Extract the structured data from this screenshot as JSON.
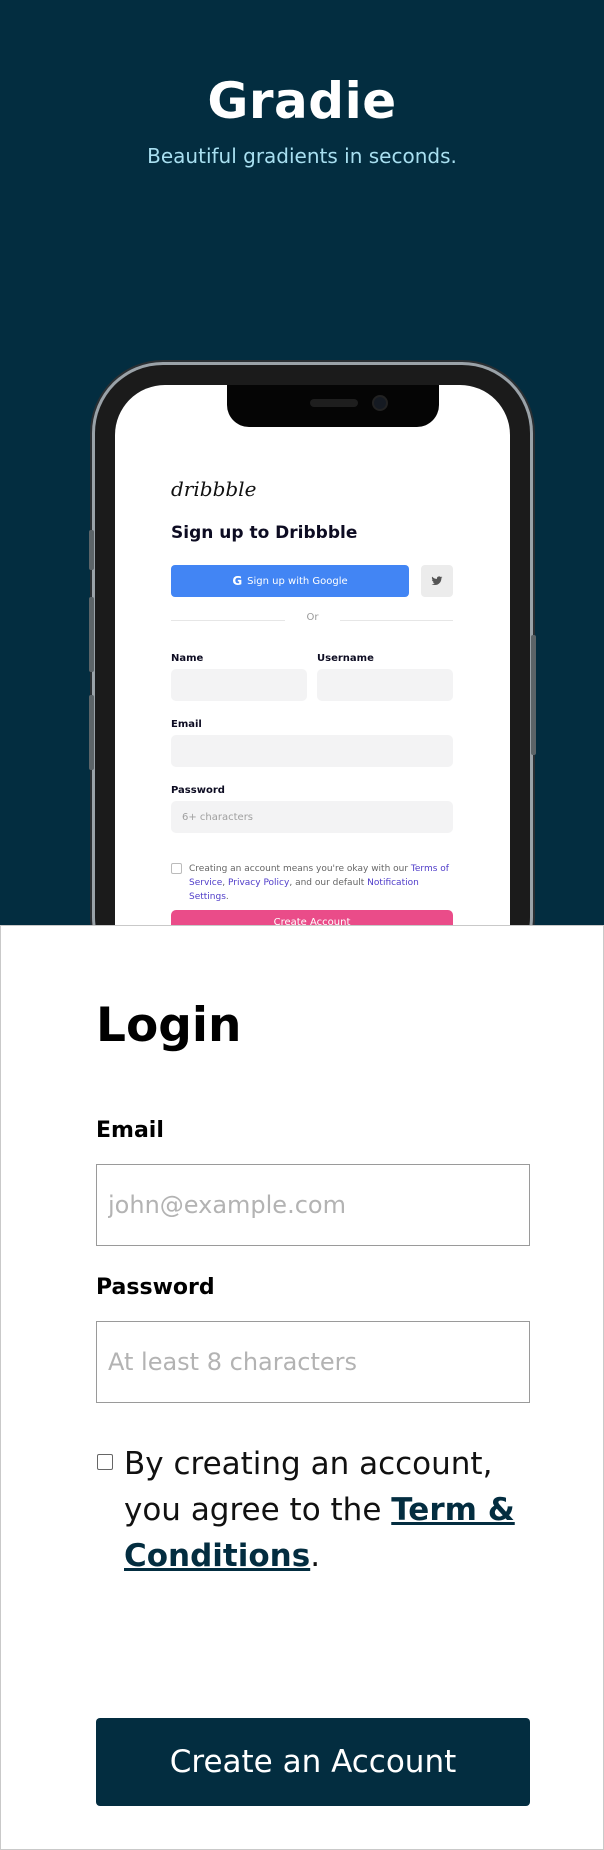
{
  "hero": {
    "brand": "Gradie",
    "tagline": "Beautiful gradients in seconds."
  },
  "phone_screen": {
    "logo": "dribbble",
    "title": "Sign up to Dribbble",
    "google_button": "Sign up with Google",
    "divider_text": "Or",
    "name_label": "Name",
    "username_label": "Username",
    "email_label": "Email",
    "password_label": "Password",
    "password_placeholder": "6+ characters",
    "terms_prefix": "Creating an account means you're okay with our ",
    "terms_link": "Terms of Service",
    "privacy_link": "Privacy Policy",
    "terms_middle": ", and our default ",
    "notification_link": "Notification Settings",
    "create_button": "Create Account"
  },
  "login": {
    "title": "Login",
    "email_label": "Email",
    "email_placeholder": "john@example.com",
    "password_label": "Password",
    "password_placeholder": "At least 8 characters",
    "agree_prefix": "By creating an account, you agree to the ",
    "agree_link": "Term & Conditions",
    "agree_suffix": ".",
    "submit_label": "Create an Account"
  },
  "colors": {
    "hero_bg": "#032d40",
    "tagline": "#a8dff0",
    "button_bg": "#032d40",
    "page_bg": "#f4b8a1"
  }
}
